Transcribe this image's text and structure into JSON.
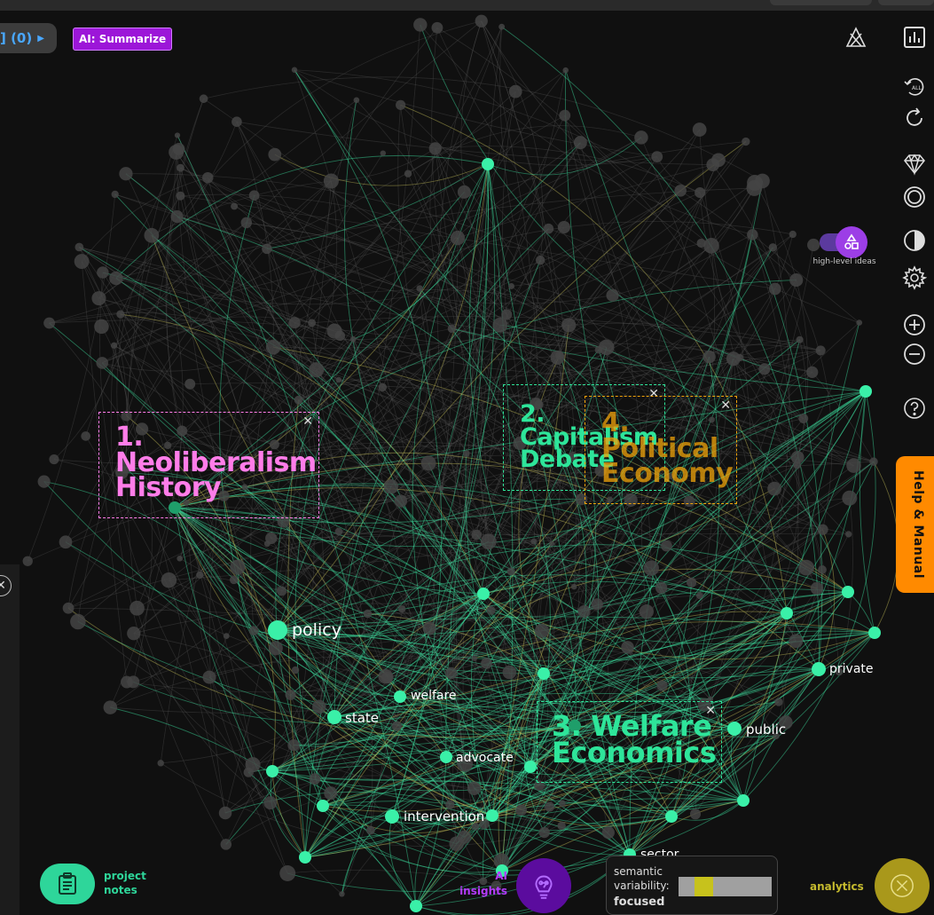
{
  "toolbar": {
    "filter_label": "] (0)",
    "ai_summarize_label": "AI: Summarize"
  },
  "toggle": {
    "label": "high-level ideas",
    "state": "on"
  },
  "help_tab": {
    "label": "Help & Manual"
  },
  "clusters": [
    {
      "number": "1.",
      "title": "Neoliberalism History",
      "color": "#ff7de9"
    },
    {
      "number": "2.",
      "title": "Capitalism Debate",
      "color": "#2ee59a"
    },
    {
      "number": "3.",
      "title": "Welfare Economics",
      "color": "#2ee59a"
    },
    {
      "number": "4.",
      "title": "Political Economy",
      "color": "#f0a30a"
    }
  ],
  "graph_words": {
    "policy": "policy",
    "welfare": "welfare",
    "state": "state",
    "advocate": "advocate",
    "intervention": "intervention",
    "sector": "sector",
    "public": "public",
    "private": "private"
  },
  "bottom": {
    "project_notes_line1": "project",
    "project_notes_line2": "notes",
    "ai_insights_line1": "AI",
    "ai_insights_line2": "insights",
    "variability_line1": "semantic",
    "variability_line2": "variability:",
    "variability_value": "focused",
    "variability_level": 0.27,
    "analytics_label": "analytics"
  },
  "colors": {
    "accent_green": "#2ee59a",
    "accent_purple": "#9c16d8",
    "help_orange": "#ff8a00",
    "analytics_gold": "#a9981b"
  }
}
